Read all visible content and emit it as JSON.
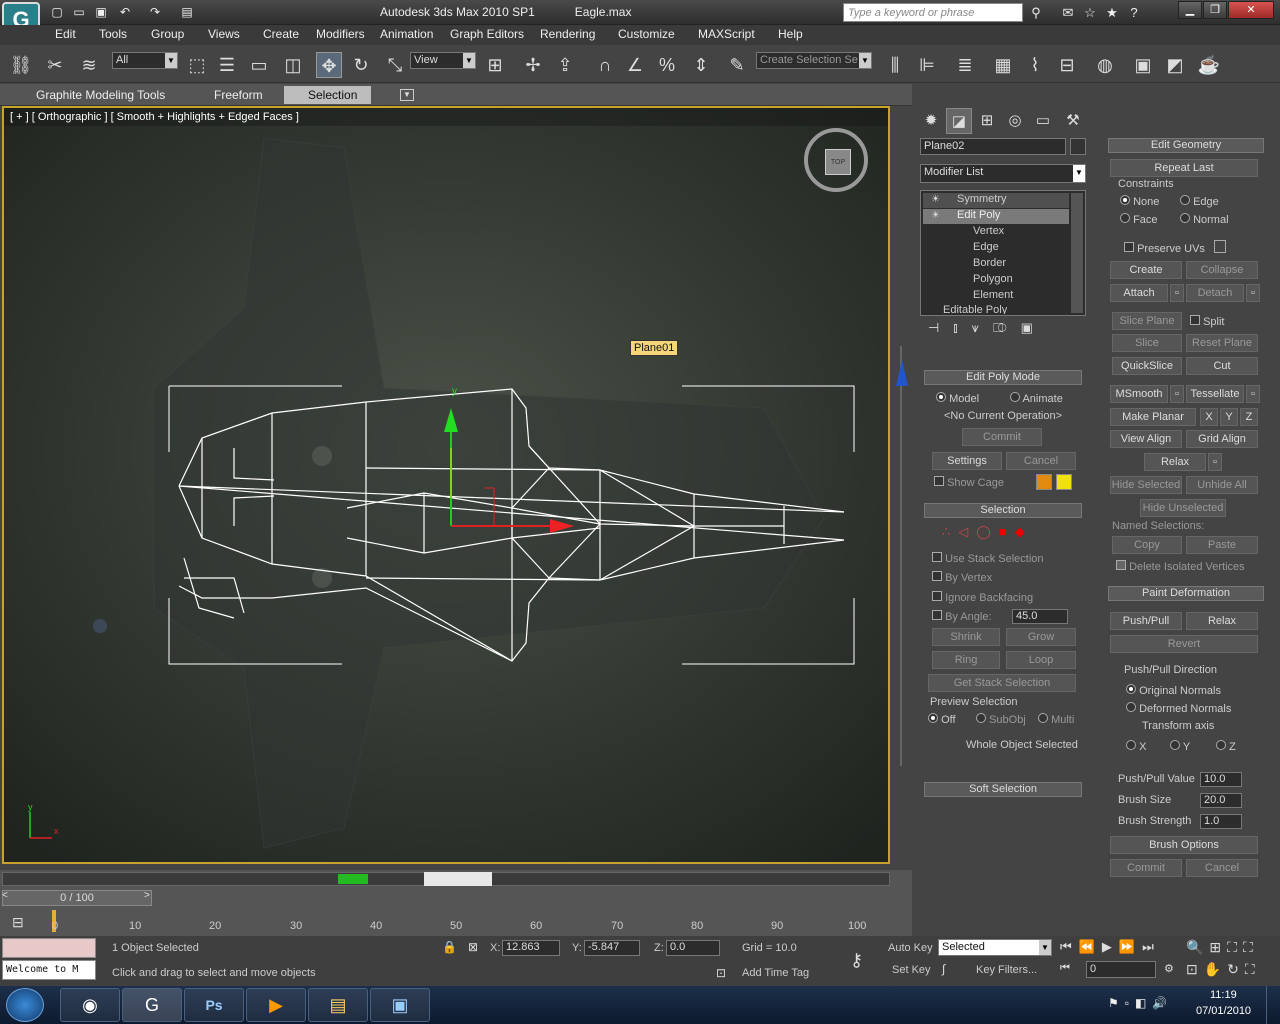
{
  "titlebar": {
    "app_title": "Autodesk 3ds Max  2010 SP1",
    "file_name": "Eagle.max",
    "search_placeholder": "Type a keyword or phrase"
  },
  "menu": [
    "Edit",
    "Tools",
    "Group",
    "Views",
    "Create",
    "Modifiers",
    "Animation",
    "Graph Editors",
    "Rendering",
    "Customize",
    "MAXScript",
    "Help"
  ],
  "toolbar": {
    "filter_value": "All",
    "coord_value": "View",
    "selection_set_value": "Create Selection Se"
  },
  "ribbon": {
    "tabs": [
      "Graphite Modeling Tools",
      "Freeform",
      "Selection"
    ],
    "active_tab": "Selection"
  },
  "viewport": {
    "label": "[ + ] [ Orthographic ] [ Smooth + Highlights + Edged Faces ]",
    "cube_face": "TOP",
    "tooltip": "Plane01",
    "axis_x": "x",
    "axis_y": "y"
  },
  "command_panel": {
    "object_name": "Plane02",
    "modifier_list": "Modifier List",
    "stack": [
      "Symmetry",
      "Edit Poly",
      "Vertex",
      "Edge",
      "Border",
      "Polygon",
      "Element",
      "Editable Poly"
    ],
    "edit_poly_mode": {
      "title": "Edit Poly Mode",
      "model": "Model",
      "animate": "Animate",
      "no_op": "<No Current Operation>",
      "commit": "Commit",
      "settings": "Settings",
      "cancel": "Cancel",
      "show_cage": "Show Cage"
    },
    "selection": {
      "title": "Selection",
      "use_stack": "Use Stack Selection",
      "by_vertex": "By Vertex",
      "ignore_backfacing": "Ignore Backfacing",
      "by_angle": "By Angle:",
      "angle_value": "45.0",
      "shrink": "Shrink",
      "grow": "Grow",
      "ring": "Ring",
      "loop": "Loop",
      "get_stack": "Get Stack Selection",
      "preview": "Preview Selection",
      "off": "Off",
      "subobj": "SubObj",
      "multi": "Multi",
      "whole": "Whole Object Selected"
    },
    "soft_selection": "Soft Selection"
  },
  "edit_geometry": {
    "title": "Edit Geometry",
    "repeat_last": "Repeat Last",
    "constraints": "Constraints",
    "none": "None",
    "edge": "Edge",
    "face": "Face",
    "normal": "Normal",
    "preserve_uvs": "Preserve UVs",
    "create": "Create",
    "collapse": "Collapse",
    "attach": "Attach",
    "detach": "Detach",
    "slice_plane": "Slice Plane",
    "split": "Split",
    "slice": "Slice",
    "reset_plane": "Reset Plane",
    "quickslice": "QuickSlice",
    "cut": "Cut",
    "msmooth": "MSmooth",
    "tessellate": "Tessellate",
    "make_planar": "Make Planar",
    "x": "X",
    "y": "Y",
    "z": "Z",
    "view_align": "View Align",
    "grid_align": "Grid Align",
    "relax": "Relax",
    "hide_selected": "Hide Selected",
    "unhide_all": "Unhide All",
    "hide_unselected": "Hide Unselected",
    "named_selections": "Named Selections:",
    "copy": "Copy",
    "paste": "Paste",
    "delete_isolated": "Delete Isolated Vertices"
  },
  "paint_deformation": {
    "title": "Paint Deformation",
    "push_pull": "Push/Pull",
    "relax": "Relax",
    "revert": "Revert",
    "direction": "Push/Pull Direction",
    "original_normals": "Original Normals",
    "deformed_normals": "Deformed Normals",
    "transform_axis": "Transform axis",
    "x": "X",
    "y": "Y",
    "z": "Z",
    "push_pull_value_label": "Push/Pull Value",
    "push_pull_value": "10.0",
    "brush_size_label": "Brush Size",
    "brush_size": "20.0",
    "brush_strength_label": "Brush Strength",
    "brush_strength": "1.0",
    "brush_options": "Brush Options",
    "commit": "Commit",
    "cancel": "Cancel"
  },
  "timeline": {
    "frame": "0 / 100",
    "ticks": [
      "0",
      "10",
      "20",
      "30",
      "40",
      "50",
      "60",
      "70",
      "80",
      "90",
      "100"
    ]
  },
  "status": {
    "welcome": "Welcome to M",
    "selected": "1 Object Selected",
    "hint": "Click and drag to select and move objects",
    "x_label": "X:",
    "x": "12.863",
    "y_label": "Y:",
    "y": "-5.847",
    "z_label": "Z:",
    "z": "0.0",
    "grid": "Grid = 10.0",
    "add_time_tag": "Add Time Tag",
    "auto_key": "Auto Key",
    "set_key": "Set Key",
    "key_mode": "Selected",
    "key_filters": "Key Filters...",
    "frame_field": "0"
  },
  "taskbar": {
    "time": "11:19",
    "date": "07/01/2010"
  }
}
